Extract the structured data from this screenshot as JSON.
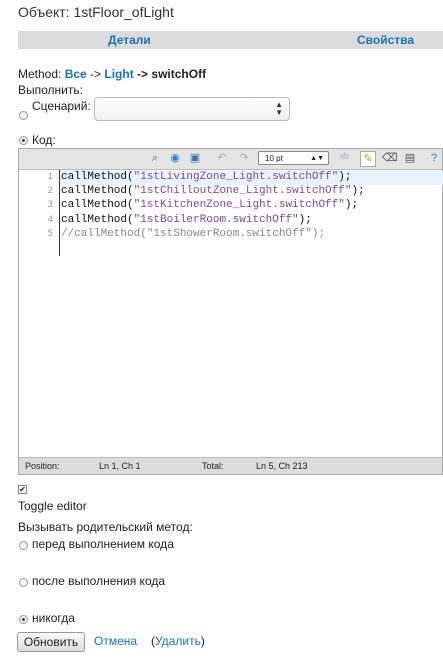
{
  "object_title": "Объект: 1stFloor_ofLight",
  "tabs": {
    "details": "Детали",
    "properties": "Свойства"
  },
  "method": {
    "prefix": "Method:",
    "all": "Все",
    "arrow1": " -> ",
    "class": "Light",
    "arrow2": " -> ",
    "name": "switchOff"
  },
  "execute_label": "Выполнить:",
  "scenario": {
    "label": "Сценарий:",
    "selected": "",
    "radio_checked": false
  },
  "code_option": {
    "label": "Код:",
    "radio_checked": true
  },
  "editor": {
    "toolbar_icons": [
      "binoculars-icon",
      "search-replace-icon",
      "fullscreen-icon",
      "undo-icon",
      "redo-icon",
      "fontsize-select",
      "spellcheck-icon",
      "highlight-icon",
      "eraser-icon",
      "save-icon",
      "help-icon"
    ],
    "font_size": "10 pt",
    "lines": [
      {
        "num": "1",
        "pre": "callMethod(",
        "str": "\"1stLivingZone_Light.switchOff\"",
        "post": ");",
        "comment": false
      },
      {
        "num": "2",
        "pre": "callMethod(",
        "str": "\"1stChilloutZone_Light.switchOff\"",
        "post": ");",
        "comment": false
      },
      {
        "num": "3",
        "pre": "callMethod(",
        "str": "\"1stKitchenZone_Light.switchOff\"",
        "post": ");",
        "comment": false
      },
      {
        "num": "4",
        "pre": "callMethod(",
        "str": "\"1stBoilerRoom.switchOff\"",
        "post": ");",
        "comment": false
      },
      {
        "num": "5",
        "pre": "//callMethod(\"1stShowerRoom.switchOff\");",
        "str": "",
        "post": "",
        "comment": true
      }
    ],
    "status": {
      "position_label": "Position:",
      "position": "Ln 1, Ch 1",
      "total_label": "Total:",
      "total": "Ln 5, Ch 213"
    }
  },
  "toggle_editor": {
    "checked": true,
    "label": "Toggle editor"
  },
  "parent_call": {
    "label": "Вызывать родительский метод:",
    "options": [
      {
        "label": "перед выполнением кода",
        "checked": false
      },
      {
        "label": "после выполнения кода",
        "checked": false
      },
      {
        "label": "никогда",
        "checked": true
      }
    ]
  },
  "actions": {
    "update": "Обновить",
    "cancel": "Отмена",
    "delete_open": "(",
    "delete": "Удалить",
    "delete_close": ")"
  },
  "colors": {
    "link": "#1a73b8",
    "tabbar": "#dcdcdc",
    "string": "#7a49a5",
    "comment": "#888888"
  }
}
